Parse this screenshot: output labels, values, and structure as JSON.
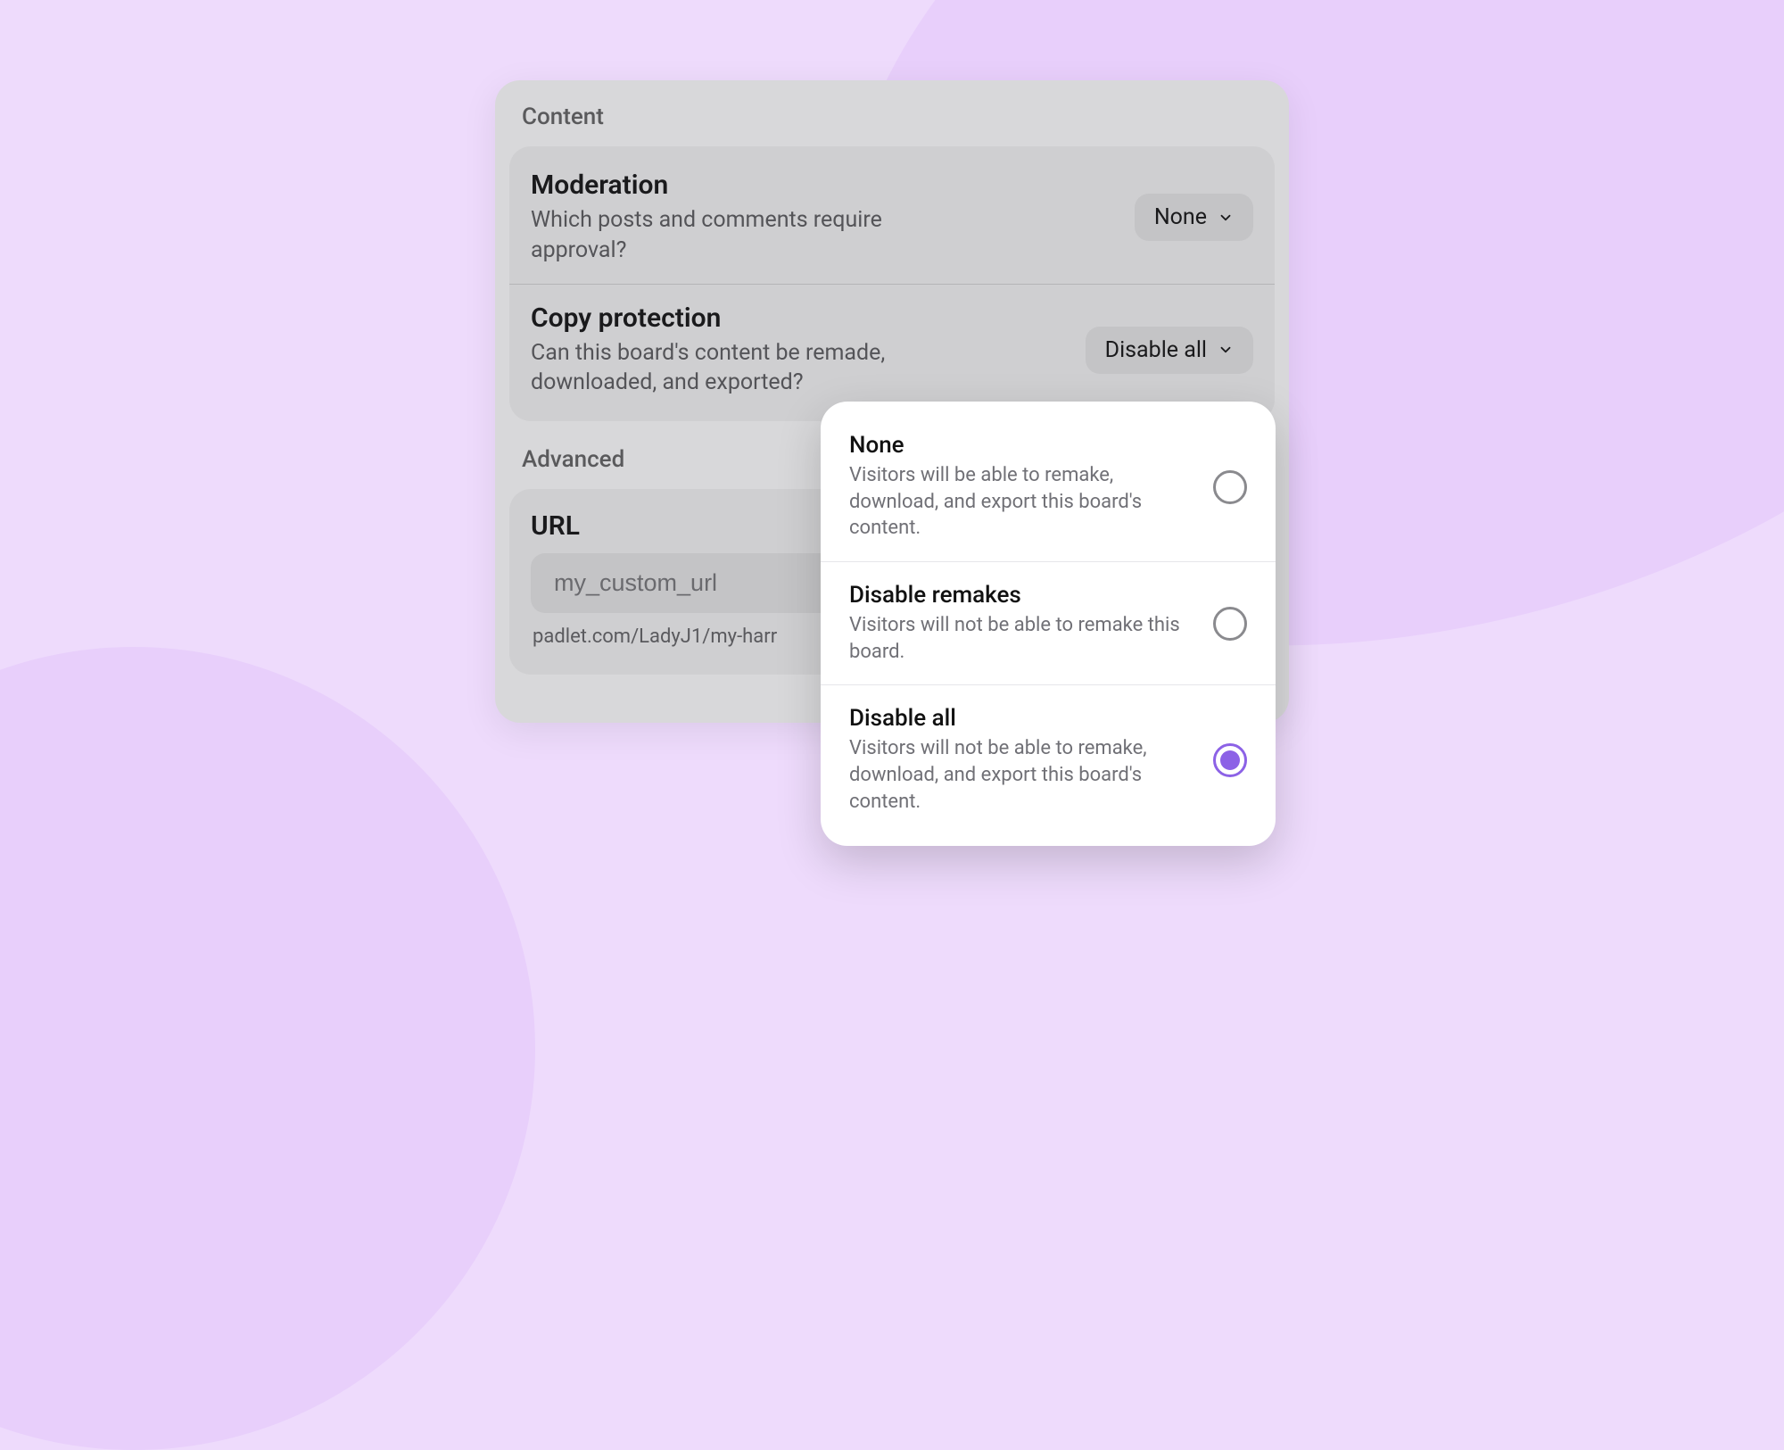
{
  "colors": {
    "accent": "#8c62e6",
    "bg": "#EEDBFC",
    "bg_shape": "#E8CFFB"
  },
  "sections": {
    "content": {
      "heading": "Content",
      "moderation": {
        "title": "Moderation",
        "desc": "Which posts and comments require approval?",
        "value": "None"
      },
      "copy_protection": {
        "title": "Copy protection",
        "desc": "Can this board's content be remade, downloaded, and exported?",
        "value": "Disable all"
      }
    },
    "advanced": {
      "heading": "Advanced",
      "url": {
        "title": "URL",
        "placeholder": "my_custom_url",
        "caption": "padlet.com/LadyJ1/my-harr"
      }
    }
  },
  "popover": {
    "options": [
      {
        "title": "None",
        "desc": "Visitors will be able to remake, download, and export this board's content.",
        "selected": false
      },
      {
        "title": "Disable remakes",
        "desc": "Visitors will not be able to remake this board.",
        "selected": false
      },
      {
        "title": "Disable all",
        "desc": "Visitors will not be able to remake, download, and export this board's content.",
        "selected": true
      }
    ]
  }
}
